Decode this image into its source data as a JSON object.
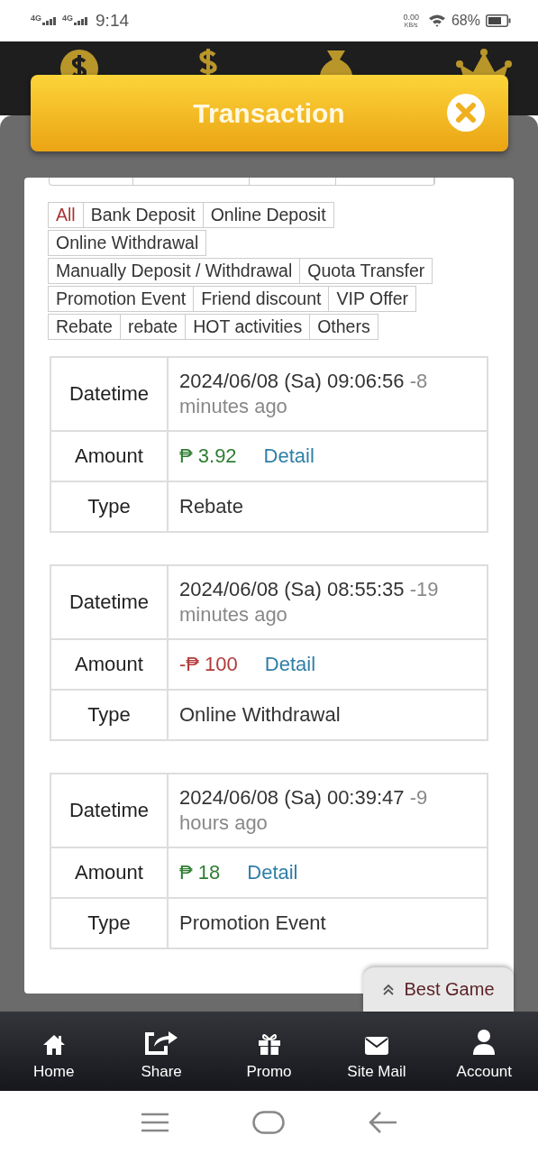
{
  "status_bar": {
    "networks": [
      "4G",
      "4G"
    ],
    "time": "9:14",
    "speed": "0.00",
    "speed_unit": "KB/s",
    "battery": "68%"
  },
  "top_icons": [
    {
      "kind": "coin"
    },
    {
      "kind": "dollar"
    },
    {
      "kind": "bag"
    },
    {
      "kind": "crown"
    }
  ],
  "dialog": {
    "title": "Transaction"
  },
  "filters": [
    {
      "label": "All",
      "selected": true
    },
    {
      "label": "Bank Deposit",
      "selected": false
    },
    {
      "label": "Online Deposit",
      "selected": false
    },
    {
      "label": "Online Withdrawal",
      "selected": false
    },
    {
      "label": "Manually Deposit / Withdrawal",
      "selected": false
    },
    {
      "label": "Quota Transfer",
      "selected": false
    },
    {
      "label": "Promotion Event",
      "selected": false
    },
    {
      "label": "Friend discount",
      "selected": false
    },
    {
      "label": "VIP Offer",
      "selected": false
    },
    {
      "label": "Rebate",
      "selected": false
    },
    {
      "label": "rebate",
      "selected": false
    },
    {
      "label": "HOT activities",
      "selected": false
    },
    {
      "label": "Others",
      "selected": false
    }
  ],
  "transactions": [
    {
      "datetime_label": "Datetime",
      "datetime": "2024/06/08 (Sa) 09:06:56",
      "ago": "-8 minutes ago",
      "amount_label": "Amount",
      "amount": "₱ 3.92",
      "color": "#2f7d32",
      "detail": "Detail",
      "type_label": "Type",
      "type": "Rebate"
    },
    {
      "datetime_label": "Datetime",
      "datetime": "2024/06/08 (Sa) 08:55:35",
      "ago": "-19 minutes ago",
      "amount_label": "Amount",
      "amount": "-₱ 100",
      "color": "#b23a3a",
      "detail": "Detail",
      "type_label": "Type",
      "type": "Online Withdrawal"
    },
    {
      "datetime_label": "Datetime",
      "datetime": "2024/06/08 (Sa) 00:39:47",
      "ago": "-9 hours ago",
      "amount_label": "Amount",
      "amount": "₱ 18",
      "color": "#2f7d32",
      "detail": "Detail",
      "type_label": "Type",
      "type": "Promotion Event"
    }
  ],
  "best_game": {
    "label": "Best Game"
  },
  "bottom_nav": [
    {
      "kind": "home",
      "label": "Home"
    },
    {
      "kind": "share",
      "label": "Share"
    },
    {
      "kind": "gift",
      "label": "Promo"
    },
    {
      "kind": "mail",
      "label": "Site Mail"
    },
    {
      "kind": "person",
      "label": "Account"
    }
  ],
  "system_nav": [
    {
      "kind": "menu"
    },
    {
      "kind": "home"
    },
    {
      "kind": "back"
    }
  ]
}
